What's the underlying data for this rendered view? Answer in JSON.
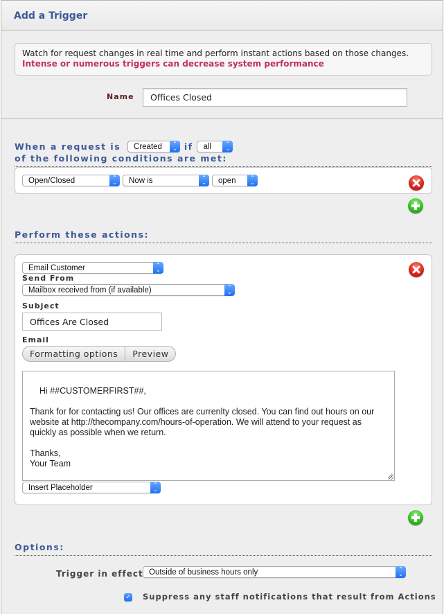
{
  "header": {
    "title": "Add a Trigger"
  },
  "info": {
    "description": "Watch for request changes in real time and perform instant actions based on those changes.",
    "warning": "Intense or numerous triggers can decrease system performance",
    "warning_color": "#c0325a"
  },
  "name_field": {
    "label": "Name",
    "value": "Offices Closed"
  },
  "conditions": {
    "prefix": "When a request is",
    "event_select": "Created",
    "connector": "if",
    "match_select": "all",
    "suffix": "of the following conditions are met:",
    "rows": [
      {
        "field": "Open/Closed",
        "operator": "Now is",
        "value": "open"
      }
    ]
  },
  "actions": {
    "heading": "Perform these actions:",
    "items": [
      {
        "type": "Email Customer",
        "send_from_label": "Send From",
        "send_from": "Mailbox received from (if available)",
        "subject_label": "Subject",
        "subject": "Offices Are Closed",
        "email_label": "Email",
        "formatting_button": "Formatting options",
        "preview_button": "Preview",
        "body": "Hi ##CUSTOMERFIRST##,\n\nThank for for contacting us! Our offices are currenlty closed. You can find out hours on our website at http://thecompany.com/hours-of-operation. We will attend to your request as quickly as possible when we return.\n\nThanks,\nYour Team",
        "placeholder_select": "Insert Placeholder"
      }
    ]
  },
  "options": {
    "heading": "Options:",
    "trigger_label": "Trigger in effect",
    "trigger_value": "Outside of business hours only",
    "suppress_label": "Suppress any staff notifications that result from Actions",
    "suppress_checked": true
  },
  "icons": {
    "remove": "remove-circle-icon",
    "add": "add-circle-icon",
    "select_arrow": "updown-chevron-icon",
    "checkmark": "✓"
  },
  "colors": {
    "heading_blue": "#3c5a99",
    "select_blue": "#1f6ff0",
    "remove_red": "#d2231a",
    "add_green": "#35b424"
  }
}
